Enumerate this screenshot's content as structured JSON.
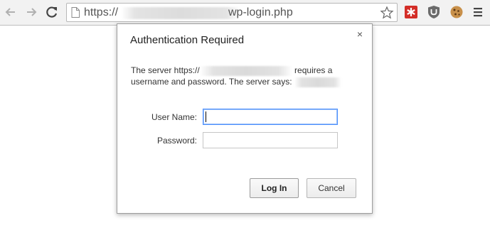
{
  "browser": {
    "url_scheme": "https://",
    "url_path": "wp-login.php"
  },
  "dialog": {
    "title": "Authentication Required",
    "close_glyph": "×",
    "message_line1_prefix": "The server https://",
    "message_line1_suffix": "requires a",
    "message_line2": "username and password. The server says:",
    "username_label": "User Name:",
    "username_value": "",
    "password_label": "Password:",
    "password_value": "",
    "login_label": "Log In",
    "cancel_label": "Cancel"
  },
  "icons": {
    "back": "back-arrow-icon",
    "forward": "forward-arrow-icon",
    "reload": "reload-icon",
    "page": "page-icon",
    "bookmark": "star-icon",
    "ext1": "lastpass-extension-icon",
    "ext2": "ublock-extension-icon",
    "ext3": "cookie-extension-icon",
    "menu": "menu-icon"
  },
  "colors": {
    "focus_border": "#4d90fe",
    "lastpass_red": "#d32d27",
    "ublock_gray": "#6b6b6b",
    "cookie_tan": "#c8904a"
  }
}
